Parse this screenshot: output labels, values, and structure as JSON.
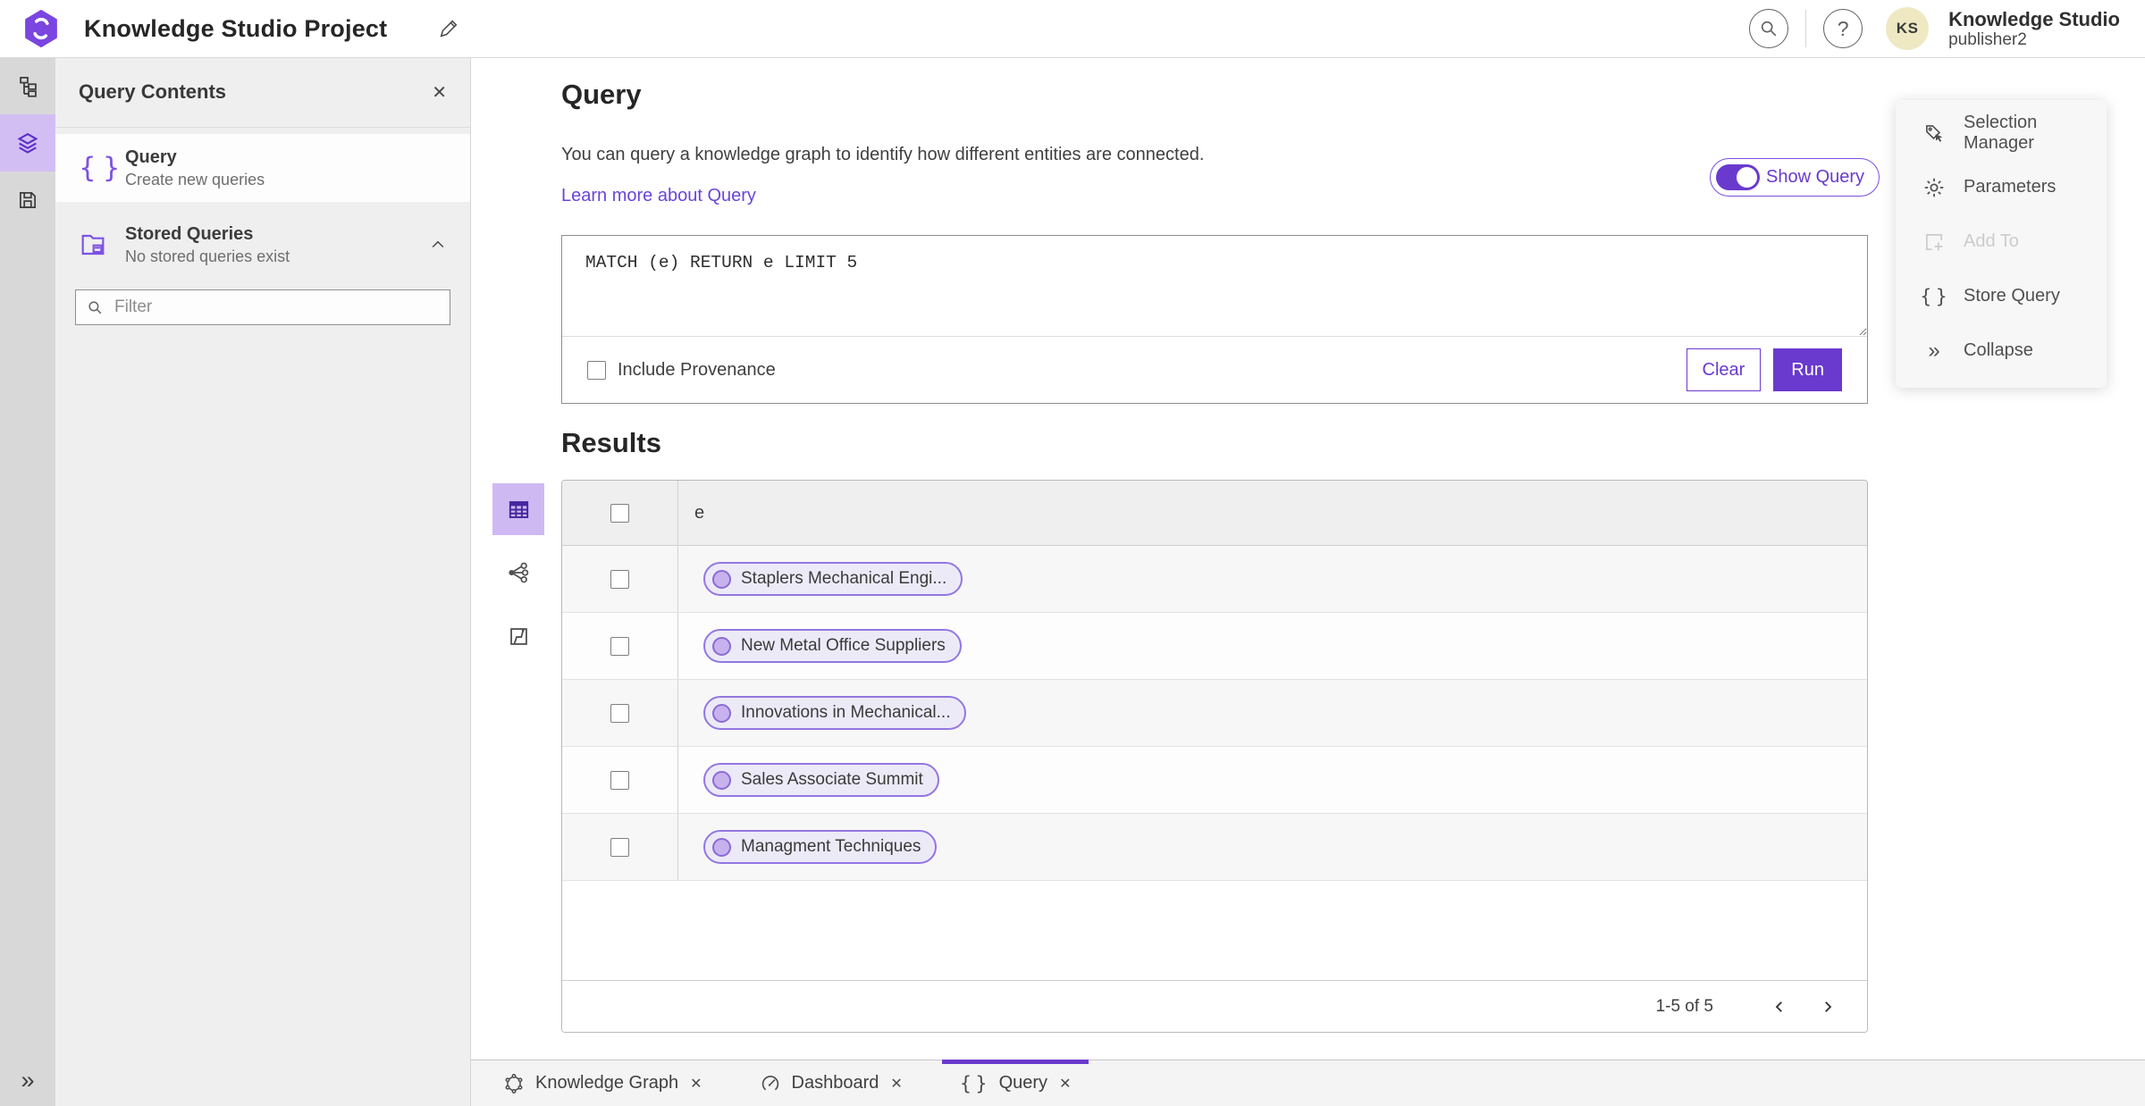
{
  "header": {
    "title": "Knowledge Studio Project",
    "user": {
      "initials": "KS",
      "name": "Knowledge Studio",
      "role": "publisher2"
    }
  },
  "panel": {
    "title": "Query Contents",
    "items": [
      {
        "title": "Query",
        "subtitle": "Create new queries"
      },
      {
        "title": "Stored Queries",
        "subtitle": "No stored queries exist"
      }
    ],
    "filter_placeholder": "Filter"
  },
  "main": {
    "title": "Query",
    "description": "You can query a knowledge graph to identify how different entities are connected.",
    "learn_more": "Learn more about Query",
    "show_query_label": "Show Query",
    "query_text": "MATCH (e) RETURN e LIMIT 5",
    "include_provenance_label": "Include Provenance",
    "clear_label": "Clear",
    "run_label": "Run",
    "results_title": "Results",
    "table": {
      "column": "e",
      "rows": [
        "Staplers Mechanical Engi...",
        "New Metal Office Suppliers",
        "Innovations in Mechanical...",
        "Sales Associate Summit",
        "Managment Techniques"
      ]
    },
    "pagination": {
      "range_label": "1-5 of 5"
    }
  },
  "context_menu": {
    "items": [
      {
        "label": "Selection Manager",
        "disabled": false
      },
      {
        "label": "Parameters",
        "disabled": false
      },
      {
        "label": "Add To",
        "disabled": true
      },
      {
        "label": "Store Query",
        "disabled": false
      },
      {
        "label": "Collapse",
        "disabled": false
      }
    ]
  },
  "tabs": [
    {
      "label": "Knowledge Graph",
      "active": false
    },
    {
      "label": "Dashboard",
      "active": false
    },
    {
      "label": "Query",
      "active": true
    }
  ],
  "colors": {
    "accent": "#6a3ace",
    "accent_light": "#cfb9f3",
    "pill_bg": "#edeaf8",
    "avatar_bg": "#eee9c3"
  }
}
